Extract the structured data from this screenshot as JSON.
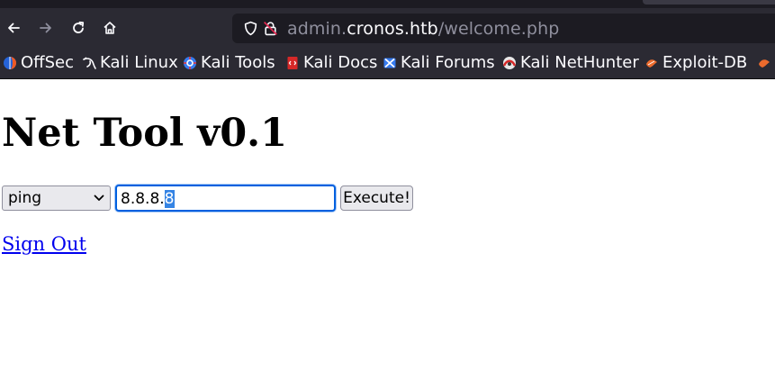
{
  "browser": {
    "url_prefix": "admin.",
    "url_host": "cronos.htb",
    "url_path": "/welcome.php"
  },
  "bookmarks": [
    {
      "label": "OffSec",
      "icon": "offsec-icon"
    },
    {
      "label": "Kali Linux",
      "icon": "kali-dragon-icon"
    },
    {
      "label": "Kali Tools",
      "icon": "kali-tools-icon"
    },
    {
      "label": "Kali Docs",
      "icon": "kali-docs-icon"
    },
    {
      "label": "Kali Forums",
      "icon": "kali-forums-icon"
    },
    {
      "label": "Kali NetHunter",
      "icon": "nethunter-icon"
    },
    {
      "label": "Exploit-DB",
      "icon": "exploit-db-icon"
    }
  ],
  "page": {
    "title": "Net Tool v0.1",
    "command_select": {
      "selected": "ping"
    },
    "host_input": {
      "value_plain": "8.8.8.",
      "value_selected": "8"
    },
    "execute_label": "Execute!",
    "signout_label": "Sign Out"
  },
  "colors": {
    "toolbar_bg": "#2b2a33",
    "urlbar_bg": "#1c1b22",
    "link": "#0000ee",
    "focus_ring": "#0060df"
  }
}
